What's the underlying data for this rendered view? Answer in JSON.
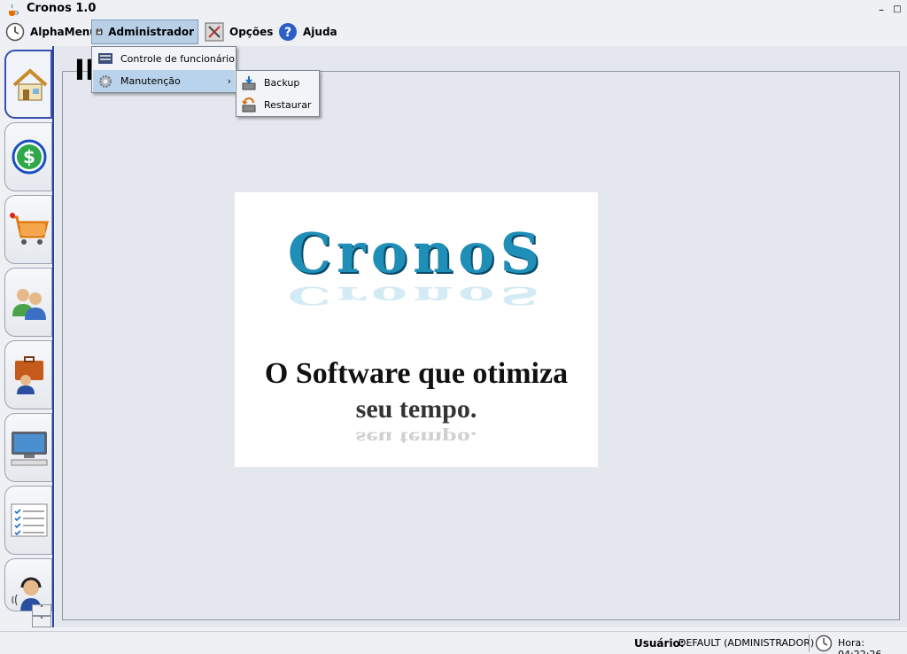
{
  "window": {
    "title": "Cronos 1.0",
    "minimize": "–",
    "maximize": "□",
    "close": "✖"
  },
  "menubar": {
    "items": [
      {
        "label": "AlphaMenu",
        "icon": "clock-icon"
      },
      {
        "label": "Administrador",
        "icon": "lock-icon",
        "active": true
      },
      {
        "label": "Opções",
        "icon": "tools-icon"
      },
      {
        "label": "Ajuda",
        "icon": "help-icon"
      }
    ]
  },
  "admin_menu": {
    "items": [
      {
        "label": "Controle de funcionário",
        "icon": "monitor-icon"
      },
      {
        "label": "Manutenção",
        "icon": "gear-icon",
        "has_submenu": true
      }
    ]
  },
  "maintenance_submenu": {
    "items": [
      {
        "label": "Backup",
        "icon": "backup-icon"
      },
      {
        "label": "Restaurar",
        "icon": "restore-icon"
      }
    ]
  },
  "sidebar": {
    "tabs": [
      {
        "name": "home",
        "icon": "home-icon",
        "selected": true
      },
      {
        "name": "finance",
        "icon": "dollar-icon"
      },
      {
        "name": "sales",
        "icon": "cart-icon"
      },
      {
        "name": "clients",
        "icon": "users-icon"
      },
      {
        "name": "employees",
        "icon": "briefcase-icon"
      },
      {
        "name": "terminal",
        "icon": "computer-icon"
      },
      {
        "name": "checklist",
        "icon": "checklist-icon"
      },
      {
        "name": "support",
        "icon": "headset-icon"
      }
    ],
    "scroll_up": "˄",
    "scroll_down": "˅"
  },
  "main": {
    "title_partial": "IN"
  },
  "splash": {
    "logo_text": "CronoS",
    "slogan_line1": "O Software que otimiza",
    "slogan_line2": "seu tempo."
  },
  "status": {
    "user_label": "Usuário:",
    "user_value": "DEFAULT (ADMINISTRADOR)",
    "time_text": "Hora: 04:22:26"
  },
  "colors": {
    "accent": "#2a3fa0",
    "menu_highlight": "#b9d3ec",
    "logo": "#1f8fb8"
  }
}
